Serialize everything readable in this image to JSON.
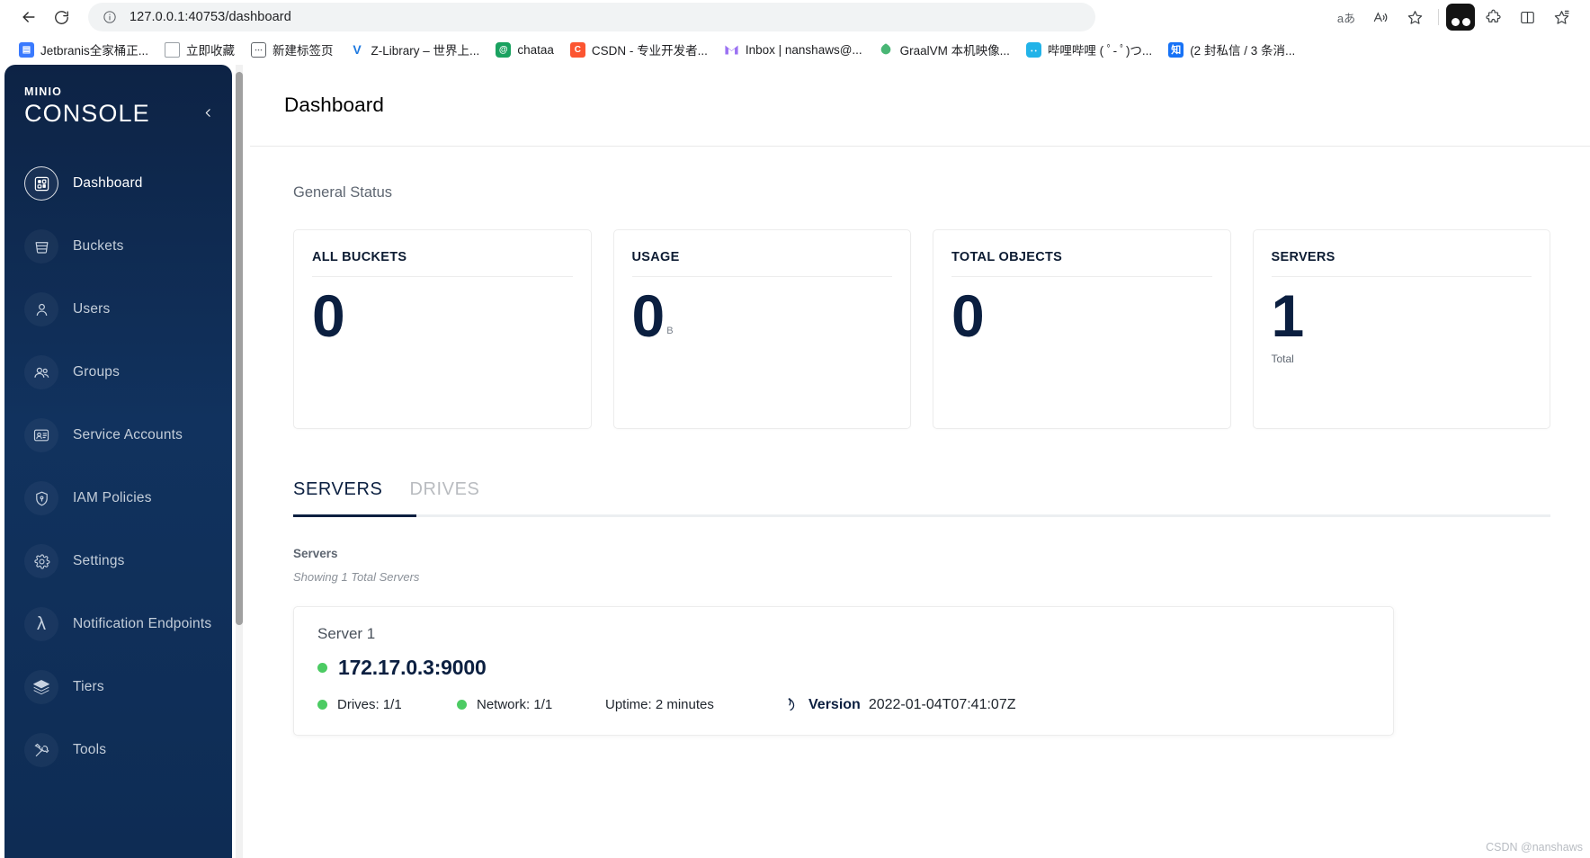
{
  "browser": {
    "back_label": "Back",
    "refresh_label": "Refresh",
    "url": "127.0.0.1:40753/dashboard",
    "site_info_label": "View site information",
    "right_icons": [
      {
        "name": "reading-language-icon",
        "glyph": "aあ"
      },
      {
        "name": "read-aloud-icon",
        "glyph": "A"
      },
      {
        "name": "favorite-star-icon",
        "glyph": "☆"
      },
      {
        "name": "collections-icon",
        "glyph": "▣"
      },
      {
        "name": "extensions-icon",
        "glyph": "🧩"
      },
      {
        "name": "split-screen-icon",
        "glyph": "◫"
      },
      {
        "name": "favorites-icon",
        "glyph": "☆"
      }
    ],
    "bookmarks": [
      {
        "label": "Jetbranis全家桶正...",
        "icon": "jetbrains-icon",
        "glyph": "▤"
      },
      {
        "label": "立即收藏",
        "icon": "document-icon",
        "glyph": ""
      },
      {
        "label": "新建标签页",
        "icon": "new-tab-icon",
        "glyph": "⋯"
      },
      {
        "label": "Z-Library – 世界上...",
        "icon": "zlibrary-icon",
        "glyph": "V"
      },
      {
        "label": "chataa",
        "icon": "chataa-icon",
        "glyph": "@"
      },
      {
        "label": "CSDN - 专业开发者...",
        "icon": "csdn-icon",
        "glyph": "C"
      },
      {
        "label": "Inbox | nanshaws@...",
        "icon": "inbox-icon",
        "glyph": "M"
      },
      {
        "label": "GraalVM 本机映像...",
        "icon": "graalvm-icon",
        "glyph": "◉"
      },
      {
        "label": "哔哩哔哩 ( ﾟ- ﾟ)つ...",
        "icon": "bilibili-icon",
        "glyph": "▭"
      },
      {
        "label": "(2 封私信 / 3 条消...",
        "icon": "zhihu-icon",
        "glyph": "知"
      }
    ]
  },
  "sidebar": {
    "logo_top": "MINIO",
    "logo_bottom": "CONSOLE",
    "collapse_label": "‹",
    "items": [
      {
        "label": "Dashboard",
        "icon": "dashboard-icon",
        "active": true
      },
      {
        "label": "Buckets",
        "icon": "bucket-icon",
        "active": false
      },
      {
        "label": "Users",
        "icon": "user-icon",
        "active": false
      },
      {
        "label": "Groups",
        "icon": "groups-icon",
        "active": false
      },
      {
        "label": "Service Accounts",
        "icon": "service-account-icon",
        "active": false
      },
      {
        "label": "IAM Policies",
        "icon": "shield-icon",
        "active": false
      },
      {
        "label": "Settings",
        "icon": "gear-icon",
        "active": false
      },
      {
        "label": "Notification Endpoints",
        "icon": "lambda-icon",
        "active": false
      },
      {
        "label": "Tiers",
        "icon": "layers-icon",
        "active": false
      },
      {
        "label": "Tools",
        "icon": "tools-icon",
        "active": false
      }
    ]
  },
  "header": {
    "title": "Dashboard"
  },
  "general_status": {
    "section_title": "General Status",
    "cards": [
      {
        "label": "ALL BUCKETS",
        "value": "0",
        "unit": "",
        "sub": ""
      },
      {
        "label": "USAGE",
        "value": "0",
        "unit": "B",
        "sub": ""
      },
      {
        "label": "TOTAL OBJECTS",
        "value": "0",
        "unit": "",
        "sub": ""
      },
      {
        "label": "SERVERS",
        "value": "1",
        "unit": "",
        "sub": "Total"
      }
    ]
  },
  "tabs": [
    {
      "label": "SERVERS",
      "active": true
    },
    {
      "label": "DRIVES",
      "active": false
    }
  ],
  "servers_section": {
    "heading": "Servers",
    "showing": "Showing 1 Total Servers",
    "servers": [
      {
        "name": "Server 1",
        "address": "172.17.0.3:9000",
        "status": "online",
        "drives": "Drives: 1/1",
        "network": "Network: 1/1",
        "uptime": "Uptime: 2 minutes",
        "version_label": "Version",
        "version_value": "2022-01-04T07:41:07Z"
      }
    ]
  },
  "watermark": "CSDN @nanshaws",
  "colors": {
    "sidebar_bg": "#0d2345",
    "accent_navy": "#0b1f40",
    "status_green": "#4ccb63"
  }
}
